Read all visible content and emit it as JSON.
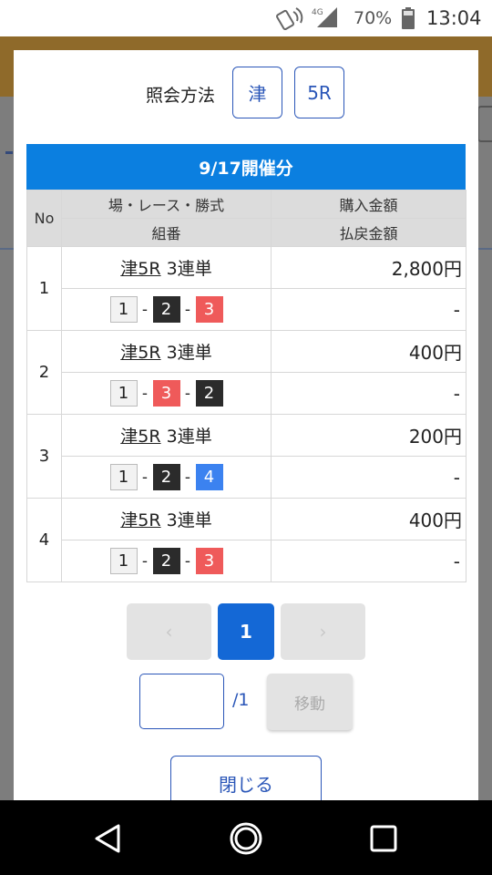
{
  "status_bar": {
    "network": "4G",
    "battery": "70%",
    "time": "13:04",
    "icons": [
      "nfc-icon",
      "signal-icon",
      "battery-icon"
    ]
  },
  "modal": {
    "query": {
      "label": "照会方法",
      "venue": "津",
      "race": "5R"
    },
    "results": {
      "heading": "9/17開催分",
      "headers": {
        "no": "No",
        "bet": "場・レース・勝式",
        "combo": "組番",
        "purchase": "購入金額",
        "refund": "払戻金額"
      },
      "rows": [
        {
          "no": "1",
          "venue": "津5R",
          "type": "3連単",
          "purchase": "2,800円",
          "refund": "-",
          "combo": [
            {
              "n": "1",
              "style": "b1"
            },
            {
              "n": "2",
              "style": "b2"
            },
            {
              "n": "3",
              "style": "b3"
            }
          ]
        },
        {
          "no": "2",
          "venue": "津5R",
          "type": "3連単",
          "purchase": "400円",
          "refund": "-",
          "combo": [
            {
              "n": "1",
              "style": "b1"
            },
            {
              "n": "3",
              "style": "b3"
            },
            {
              "n": "2",
              "style": "b2"
            }
          ]
        },
        {
          "no": "3",
          "venue": "津5R",
          "type": "3連単",
          "purchase": "200円",
          "refund": "-",
          "combo": [
            {
              "n": "1",
              "style": "b1"
            },
            {
              "n": "2",
              "style": "b2"
            },
            {
              "n": "4",
              "style": "b4"
            }
          ]
        },
        {
          "no": "4",
          "venue": "津5R",
          "type": "3連単",
          "purchase": "400円",
          "refund": "-",
          "combo": [
            {
              "n": "1",
              "style": "b1"
            },
            {
              "n": "2",
              "style": "b2"
            },
            {
              "n": "3",
              "style": "b3"
            }
          ]
        }
      ],
      "separator": "-"
    },
    "pagination": {
      "prev": "‹",
      "current": "1",
      "next": "›"
    },
    "jump": {
      "value": "",
      "total": "/1",
      "button": "移動"
    },
    "close": "閉じる"
  },
  "colors": {
    "header_blue": "#0b7fe0",
    "accent_blue": "#2a56b8",
    "page_active": "#1468d6",
    "boat_2": "#2b2b2b",
    "boat_3": "#ef5a5a",
    "boat_4": "#3b82f0"
  }
}
